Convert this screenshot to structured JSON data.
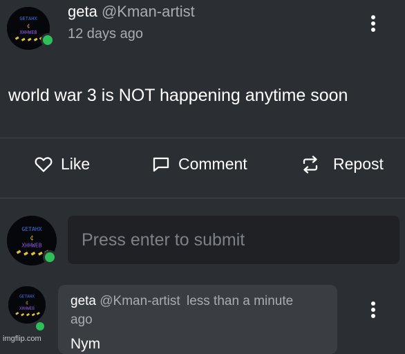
{
  "post": {
    "author_name": "geta",
    "author_handle": "@Kman-artist",
    "time": "12 days ago",
    "body": "world war 3 is NOT happening anytime soon"
  },
  "actions": {
    "like_label": "Like",
    "comment_label": "Comment",
    "repost_label": "Repost"
  },
  "composer": {
    "placeholder": "Press enter to submit"
  },
  "comment": {
    "author_name": "geta",
    "author_handle": "@Kman-artist",
    "time_line1": "less than a minute",
    "time_line2": "ago",
    "body": "Nym"
  },
  "avatar_text": {
    "top": "GETAHX",
    "mid": "¢",
    "bottom": "XHHWEB"
  },
  "watermark": "imgflip.com",
  "colors": {
    "background": "#2b2e32",
    "input_bg": "#1f2124",
    "card_bg": "#3a3d42",
    "online": "#2fbf5a",
    "muted_text": "#a9adb3"
  },
  "icons": [
    "kebab-menu-icon",
    "heart-icon",
    "comment-icon",
    "repost-icon"
  ]
}
